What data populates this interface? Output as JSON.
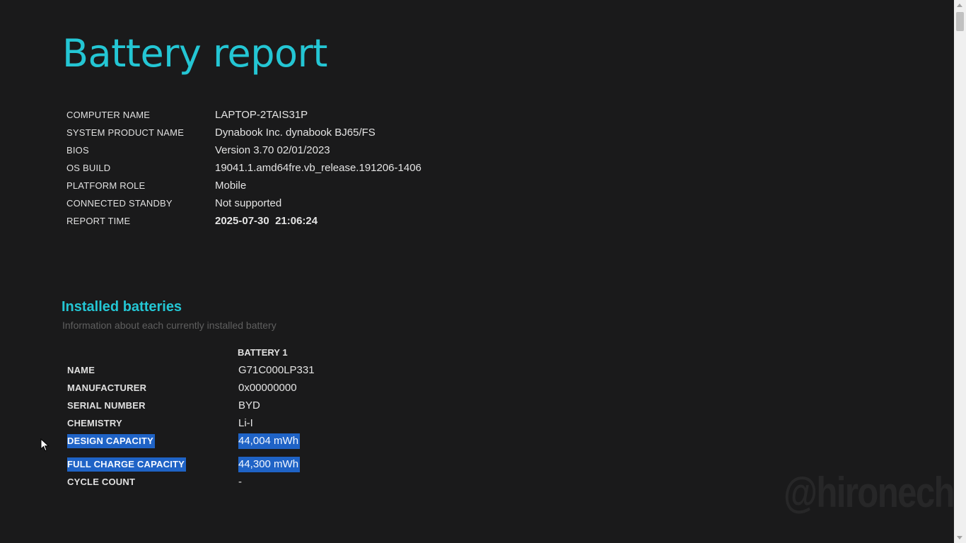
{
  "report": {
    "title": "Battery report"
  },
  "system_info": [
    {
      "label": "COMPUTER NAME",
      "value": "LAPTOP-2TAIS31P"
    },
    {
      "label": "SYSTEM PRODUCT NAME",
      "value": "Dynabook Inc. dynabook BJ65/FS"
    },
    {
      "label": "BIOS",
      "value": "Version 3.70 02/01/2023"
    },
    {
      "label": "OS BUILD",
      "value": "19041.1.amd64fre.vb_release.191206-1406"
    },
    {
      "label": "PLATFORM ROLE",
      "value": "Mobile"
    },
    {
      "label": "CONNECTED STANDBY",
      "value": "Not supported"
    },
    {
      "label": "REPORT TIME",
      "value": "2025-07-30  21:06:24"
    }
  ],
  "installed_batteries": {
    "title": "Installed batteries",
    "subtitle": "Information about each currently installed battery",
    "column_header": "BATTERY 1",
    "rows": [
      {
        "label": "NAME",
        "value": "G71C000LP331"
      },
      {
        "label": "MANUFACTURER",
        "value": "0x00000000"
      },
      {
        "label": "SERIAL NUMBER",
        "value": "BYD"
      },
      {
        "label": "CHEMISTRY",
        "value": "Li-I"
      },
      {
        "label": "DESIGN CAPACITY",
        "value": "44,004 mWh"
      },
      {
        "label": "FULL CHARGE CAPACITY",
        "value": "44,300 mWh"
      },
      {
        "label": "CYCLE COUNT",
        "value": "-"
      }
    ]
  },
  "watermark": "@hironechan",
  "colors": {
    "background": "#1a1a1b",
    "accent": "#24c6d4",
    "selection": "#1f63c6"
  }
}
